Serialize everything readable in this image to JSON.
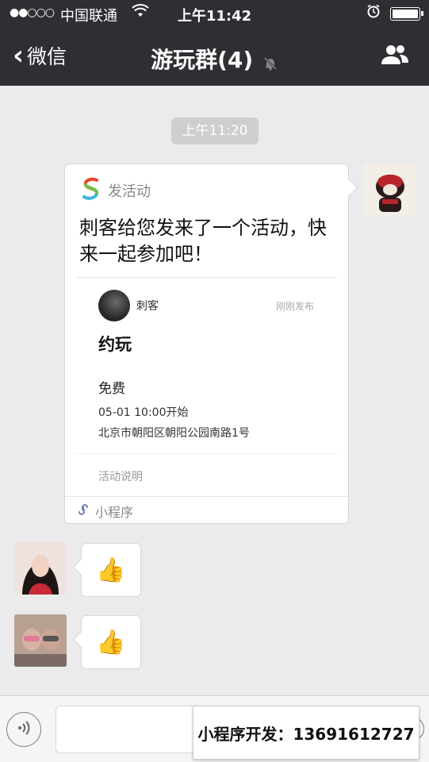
{
  "status_bar": {
    "signal": "●●○○○",
    "carrier": "中国联通",
    "time": "上午11:42"
  },
  "nav": {
    "back_label": "微信",
    "title": "游玩群(4)"
  },
  "chat": {
    "timestamp": "上午11:20",
    "card": {
      "app_name": "发活动",
      "headline": "刺客给您发来了一个活动，快来一起参加吧！",
      "host_name": "刺客",
      "posted": "刚刚发布",
      "event_title": "约玩",
      "price": "免费",
      "start_time": "05-01 10:00开始",
      "address": "北京市朝阳区朝阳公园南路1号",
      "description_label": "活动说明",
      "footer_label": "小程序"
    },
    "reactions": [
      {
        "emoji": "👍"
      },
      {
        "emoji": "👍"
      }
    ]
  },
  "watermark": "小程序开发：13691612727",
  "colors": {
    "header_bg": "#2e2e33",
    "chat_bg": "#ebebeb",
    "bubble_bg": "#ffffff"
  }
}
